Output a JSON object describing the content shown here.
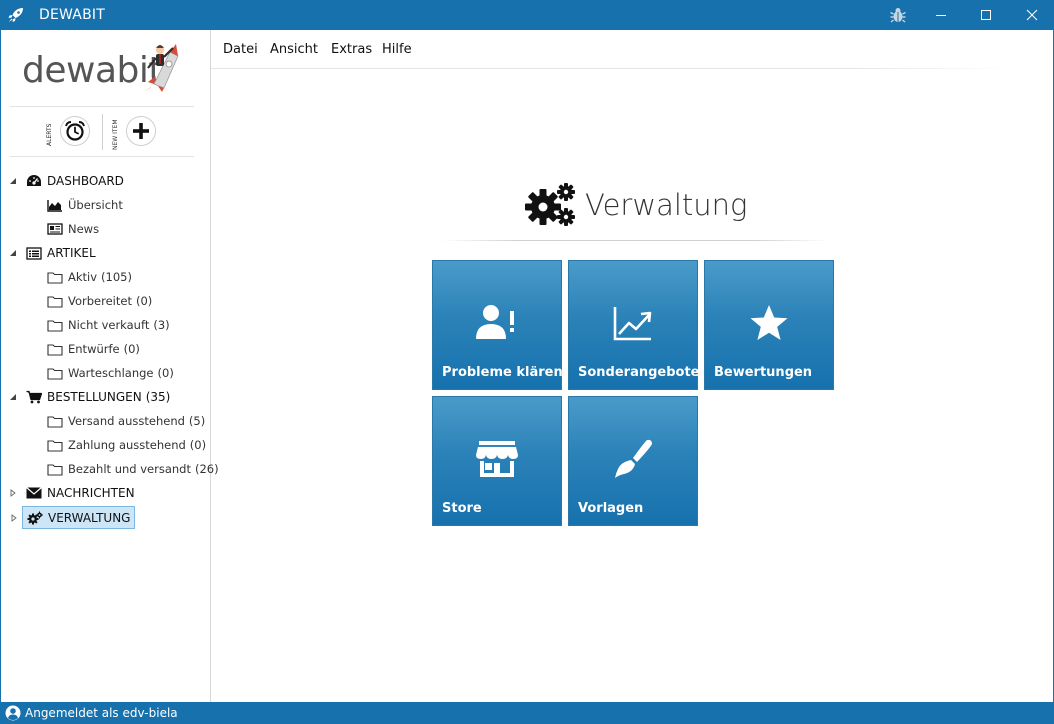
{
  "window": {
    "title": "DEWABIT",
    "icons": {
      "app": "rocket-icon",
      "bug": "bug-icon",
      "minimize": "minimize-icon",
      "maximize": "maximize-icon",
      "close": "close-icon"
    }
  },
  "logo": {
    "text": "dewabit"
  },
  "quick_actions": {
    "alerts_label": "ALERTS",
    "new_item_label": "NEW ITEM",
    "alerts_icon": "alarm-clock-icon",
    "new_item_icon": "plus-icon"
  },
  "tree": {
    "dashboard": {
      "label": "DASHBOARD",
      "children": [
        {
          "label": "Übersicht",
          "icon": "area-chart-icon"
        },
        {
          "label": "News",
          "icon": "newspaper-icon"
        }
      ]
    },
    "artikel": {
      "label": "ARTIKEL",
      "children": [
        {
          "label": "Aktiv",
          "count": "(105)"
        },
        {
          "label": "Vorbereitet",
          "count": "(0)"
        },
        {
          "label": "Nicht verkauft",
          "count": "(3)"
        },
        {
          "label": "Entwürfe",
          "count": "(0)"
        },
        {
          "label": "Warteschlange",
          "count": "(0)"
        }
      ]
    },
    "bestellungen": {
      "label": "BESTELLUNGEN",
      "count": "(35)",
      "children": [
        {
          "label": "Versand ausstehend",
          "count": "(5)"
        },
        {
          "label": "Zahlung ausstehend",
          "count": "(0)"
        },
        {
          "label": "Bezahlt und versandt",
          "count": "(26)"
        }
      ]
    },
    "nachrichten": {
      "label": "NACHRICHTEN"
    },
    "verwaltung": {
      "label": "VERWALTUNG",
      "selected": true
    }
  },
  "menu": {
    "items": [
      "Datei",
      "Ansicht",
      "Extras",
      "Hilfe"
    ]
  },
  "main": {
    "title": "Verwaltung",
    "title_icon": "gears-icon",
    "tiles": [
      {
        "label": "Probleme klären",
        "icon": "user-alert-icon"
      },
      {
        "label": "Sonderangebote",
        "icon": "trend-chart-icon"
      },
      {
        "label": "Bewertungen",
        "icon": "star-icon"
      },
      {
        "label": "Store",
        "icon": "store-icon"
      },
      {
        "label": "Vorlagen",
        "icon": "paintbrush-icon"
      }
    ]
  },
  "status": {
    "prefix": "Angemeldet als",
    "user": "edv-biela",
    "icon": "user-circle-icon"
  },
  "colors": {
    "accent": "#1671ad",
    "tile_top": "#4a9bc9",
    "tile_bottom": "#1671ad",
    "selected_bg": "#cde6f7"
  }
}
